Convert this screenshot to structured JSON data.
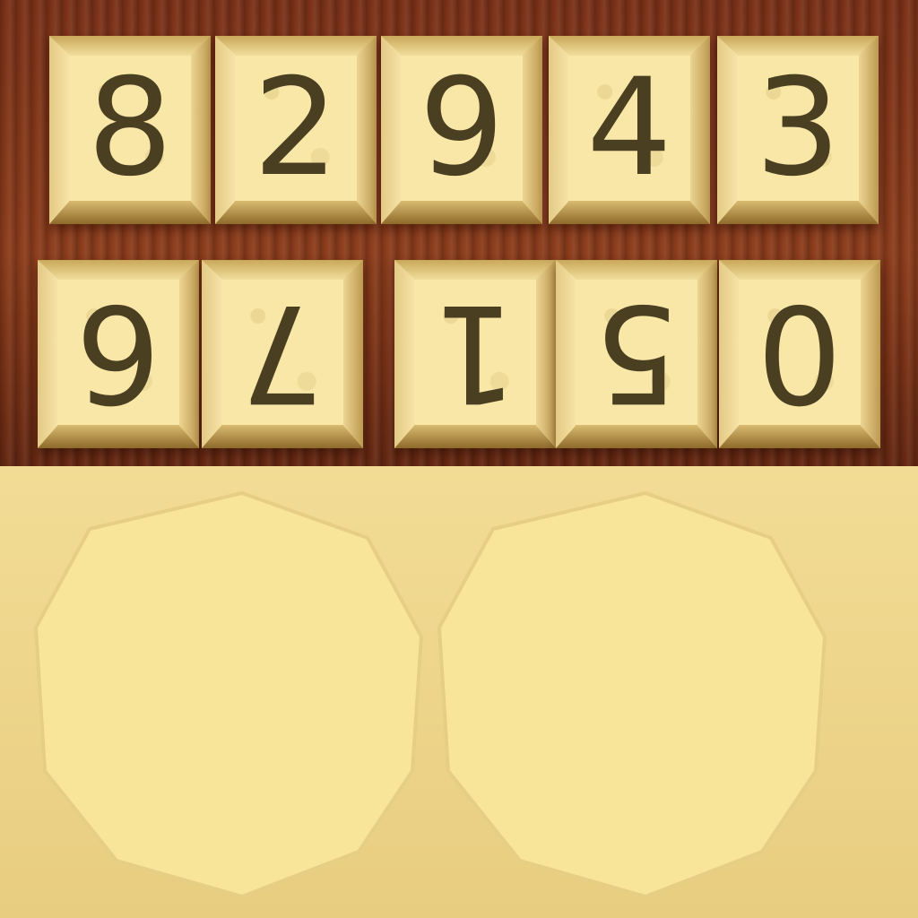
{
  "tiles_row1": [
    "8",
    "2",
    "9",
    "4",
    "3"
  ],
  "tiles_row2": [
    "6",
    "7",
    "1",
    "5",
    "0"
  ],
  "colors": {
    "tile_face": "#f8e7a6",
    "digit": "#4b3f22",
    "wood": "#7a3118",
    "disc": "#f8e59a"
  }
}
